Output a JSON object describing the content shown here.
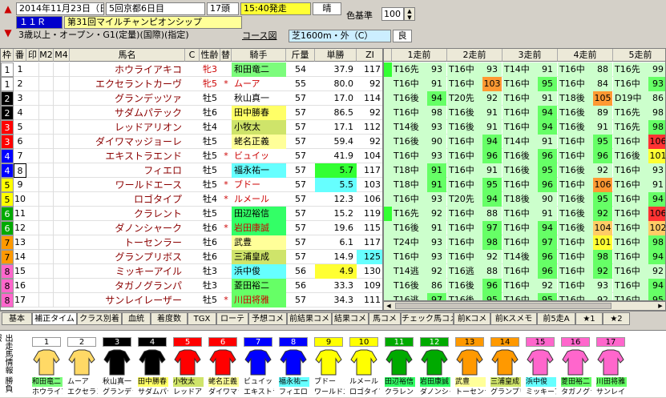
{
  "header": {
    "date": "2014年11月23日（日）",
    "meeting": "5回京都6日目",
    "field": "17頭",
    "post_time": "15:40発走",
    "weather": "晴",
    "race_no": "１１Ｒ",
    "race_name": "第31回マイルチャンピオンシップ",
    "conditions": "3歳以上・オープン・G1(定量)(国際)(指定)",
    "course_btn": "コース図",
    "course": "芝1600m・外（C）",
    "going": "良",
    "color_ref_label": "色基準",
    "color_ref_value": "100"
  },
  "columns": [
    "枠",
    "番",
    "印",
    "M2",
    "M4",
    "馬名",
    "C",
    "性齢",
    "替",
    "騎手",
    "斤量",
    "単勝",
    "ZI"
  ],
  "past_headers": [
    "1走前",
    "2走前",
    "3走前",
    "4走前",
    "5走前"
  ],
  "horses": [
    {
      "waku": "1",
      "ban": "1",
      "name": "ホウライアキコ",
      "sex": "牝3",
      "kae": "",
      "jockey": "和田竜二",
      "jc": "#7cfc7c",
      "weight": "54",
      "odds": "37.9",
      "zi": "117",
      "oc": ""
    },
    {
      "waku": "1",
      "ban": "2",
      "name": "エクセラントカーヴ",
      "sex": "牝5",
      "kae": "*",
      "jockey": "ムーア",
      "jc": "",
      "weight": "55",
      "odds": "80.0",
      "zi": "92",
      "oc": ""
    },
    {
      "waku": "2",
      "ban": "3",
      "name": "グランデッツァ",
      "sex": "牡5",
      "kae": "",
      "jockey": "秋山真一",
      "jc": "",
      "weight": "57",
      "odds": "17.0",
      "zi": "114",
      "oc": ""
    },
    {
      "waku": "2",
      "ban": "4",
      "name": "サダムパテック",
      "sex": "牡6",
      "kae": "",
      "jockey": "田中勝春",
      "jc": "#ffff66",
      "weight": "57",
      "odds": "86.5",
      "zi": "92",
      "oc": ""
    },
    {
      "waku": "3",
      "ban": "5",
      "name": "レッドアリオン",
      "sex": "牡4",
      "kae": "",
      "jockey": "小牧太",
      "jc": "#cfe46a",
      "weight": "57",
      "odds": "17.1",
      "zi": "112",
      "oc": ""
    },
    {
      "waku": "3",
      "ban": "6",
      "name": "ダイワマッジョーレ",
      "sex": "牡5",
      "kae": "",
      "jockey": "蛯名正義",
      "jc": "#ffff99",
      "weight": "57",
      "odds": "59.4",
      "zi": "92",
      "oc": ""
    },
    {
      "waku": "4",
      "ban": "7",
      "name": "エキストラエンド",
      "sex": "牡5",
      "kae": "*",
      "jockey": "ビュイッ",
      "jc": "",
      "weight": "57",
      "odds": "41.9",
      "zi": "104",
      "oc": ""
    },
    {
      "waku": "4",
      "ban": "8",
      "name": "フィエロ",
      "sex": "牡5",
      "kae": "",
      "jockey": "福永祐一",
      "jc": "#66ffff",
      "weight": "57",
      "odds": "5.7",
      "zi": "117",
      "oc": "#33ff33"
    },
    {
      "waku": "5",
      "ban": "9",
      "name": "ワールドエース",
      "sex": "牡5",
      "kae": "*",
      "jockey": "ブドー",
      "jc": "",
      "weight": "57",
      "odds": "5.5",
      "zi": "103",
      "oc": "#66ffff"
    },
    {
      "waku": "5",
      "ban": "10",
      "name": "ロゴタイプ",
      "sex": "牡4",
      "kae": "*",
      "jockey": "ルメール",
      "jc": "",
      "weight": "57",
      "odds": "12.3",
      "zi": "106",
      "oc": ""
    },
    {
      "waku": "6",
      "ban": "11",
      "name": "クラレント",
      "sex": "牡5",
      "kae": "",
      "jockey": "田辺裕信",
      "jc": "#33ff66",
      "weight": "57",
      "odds": "15.2",
      "zi": "119",
      "oc": ""
    },
    {
      "waku": "6",
      "ban": "12",
      "name": "ダノンシャーク",
      "sex": "牡6",
      "kae": "*",
      "jockey": "岩田康誠",
      "jc": "#33ff66",
      "weight": "57",
      "odds": "19.6",
      "zi": "115",
      "oc": ""
    },
    {
      "waku": "7",
      "ban": "13",
      "name": "トーセンラー",
      "sex": "牡6",
      "kae": "",
      "jockey": "武豊",
      "jc": "#ffff99",
      "weight": "57",
      "odds": "6.1",
      "zi": "117",
      "oc": ""
    },
    {
      "waku": "7",
      "ban": "14",
      "name": "グランプリボス",
      "sex": "牡6",
      "kae": "",
      "jockey": "三浦皇成",
      "jc": "#cfe46a",
      "weight": "57",
      "odds": "14.9",
      "zi": "125",
      "oc": ""
    },
    {
      "waku": "8",
      "ban": "15",
      "name": "ミッキーアイル",
      "sex": "牡3",
      "kae": "",
      "jockey": "浜中俊",
      "jc": "#66ffff",
      "weight": "56",
      "odds": "4.9",
      "zi": "130",
      "oc": "#ffff33"
    },
    {
      "waku": "8",
      "ban": "16",
      "name": "タガノグランパ",
      "sex": "牡3",
      "kae": "",
      "jockey": "菱田裕二",
      "jc": "#66ff66",
      "weight": "56",
      "odds": "33.3",
      "zi": "109",
      "oc": ""
    },
    {
      "waku": "8",
      "ban": "17",
      "name": "サンレイレーザー",
      "sex": "牡5",
      "kae": "*",
      "jockey": "川田将雅",
      "jc": "#66ff66",
      "weight": "57",
      "odds": "34.3",
      "zi": "111",
      "oc": ""
    }
  ],
  "past": [
    [
      [
        "T16先",
        "93"
      ],
      [
        "T16中",
        "93"
      ],
      [
        "T14中",
        "91"
      ],
      [
        "T16中",
        "88"
      ],
      [
        "T16先",
        "99"
      ]
    ],
    [
      [
        "T16中",
        "91"
      ],
      [
        "T16中",
        "103"
      ],
      [
        "T16中",
        "95"
      ],
      [
        "T16中",
        "84"
      ],
      [
        "T16中",
        "93"
      ]
    ],
    [
      [
        "T16後",
        "94"
      ],
      [
        "T20先",
        "92"
      ],
      [
        "T16中",
        "91"
      ],
      [
        "T18後",
        "105"
      ],
      [
        "D19中",
        "86"
      ]
    ],
    [
      [
        "T16中",
        "98"
      ],
      [
        "T16後",
        "91"
      ],
      [
        "T16中",
        "94"
      ],
      [
        "T16後",
        "89"
      ],
      [
        "T16先",
        "98"
      ]
    ],
    [
      [
        "T14後",
        "93"
      ],
      [
        "T16後",
        "91"
      ],
      [
        "T16中",
        "94"
      ],
      [
        "T16後",
        "91"
      ],
      [
        "T16先",
        "98"
      ]
    ],
    [
      [
        "T16後",
        "90"
      ],
      [
        "T16中",
        "94"
      ],
      [
        "T14中",
        "91"
      ],
      [
        "T16中",
        "95"
      ],
      [
        "T16中",
        "106"
      ]
    ],
    [
      [
        "T16中",
        "93"
      ],
      [
        "T16中",
        "96"
      ],
      [
        "T16後",
        "96"
      ],
      [
        "T16中",
        "96"
      ],
      [
        "T16後",
        "101"
      ]
    ],
    [
      [
        "T18中",
        "91"
      ],
      [
        "T16中",
        "91"
      ],
      [
        "T16後",
        "95"
      ],
      [
        "T16後",
        "92"
      ],
      [
        "T16中",
        "93"
      ]
    ],
    [
      [
        "T18中",
        "91"
      ],
      [
        "T16中",
        "95"
      ],
      [
        "T16中",
        "96"
      ],
      [
        "T16中",
        "106"
      ],
      [
        "T16中",
        "91"
      ]
    ],
    [
      [
        "T16中",
        "93"
      ],
      [
        "T20先",
        "94"
      ],
      [
        "T18後",
        "90"
      ],
      [
        "T16後",
        "95"
      ],
      [
        "T16中",
        "94"
      ]
    ],
    [
      [
        "T16先",
        "92"
      ],
      [
        "T16中",
        "88"
      ],
      [
        "T16中",
        "91"
      ],
      [
        "T16後",
        "92"
      ],
      [
        "T16中",
        "106"
      ]
    ],
    [
      [
        "T16後",
        "91"
      ],
      [
        "T16中",
        "97"
      ],
      [
        "T16中",
        "94"
      ],
      [
        "T16後",
        "104"
      ],
      [
        "T16中",
        "102"
      ]
    ],
    [
      [
        "T24中",
        "93"
      ],
      [
        "T16中",
        "98"
      ],
      [
        "T16中",
        "97"
      ],
      [
        "T16中",
        "101"
      ],
      [
        "T16中",
        "98"
      ]
    ],
    [
      [
        "T16中",
        "93"
      ],
      [
        "T16中",
        "92"
      ],
      [
        "T14後",
        "96"
      ],
      [
        "T16中",
        "98"
      ],
      [
        "T16中",
        "94"
      ]
    ],
    [
      [
        "T14逃",
        "92"
      ],
      [
        "T16逃",
        "88"
      ],
      [
        "T16中",
        "96"
      ],
      [
        "T16中",
        "92"
      ],
      [
        "T16中",
        "92"
      ]
    ],
    [
      [
        "T16後",
        "86"
      ],
      [
        "T16後",
        "96"
      ],
      [
        "T16中",
        "92"
      ],
      [
        "T16中",
        "93"
      ],
      [
        "T16中",
        "94"
      ]
    ],
    [
      [
        "T16逃",
        "97"
      ],
      [
        "T16後",
        "95"
      ],
      [
        "T16中",
        "95"
      ],
      [
        "T16中",
        "92"
      ],
      [
        "T16中",
        "95"
      ]
    ]
  ],
  "past_colors": [
    [
      "#ccffcc",
      "#ccffcc",
      "#ccffcc",
      "#ccffcc",
      "#ccffcc"
    ],
    [
      "#ccffcc",
      "#ff9933",
      "#66ff66",
      "#ccffcc",
      "#66ff66"
    ],
    [
      "#66ff66",
      "#ccffcc",
      "#ccffcc",
      "#ff9933",
      "#ccffcc"
    ],
    [
      "#ccffcc",
      "#ccffcc",
      "#66ff66",
      "#ccffcc",
      "#ccffcc"
    ],
    [
      "#ccffcc",
      "#ccffcc",
      "#66ff66",
      "#ccffcc",
      "#66ff66"
    ],
    [
      "#ccffcc",
      "#66ff66",
      "#ccffcc",
      "#66ff66",
      "#ff3333"
    ],
    [
      "#ccffcc",
      "#66ff66",
      "#66ff66",
      "#66ff66",
      "#ffff33"
    ],
    [
      "#66ff66",
      "#ccffcc",
      "#66ff66",
      "#ccffcc",
      "#ccffcc"
    ],
    [
      "#66ff66",
      "#66ff66",
      "#66ff66",
      "#ff9933",
      "#ccffcc"
    ],
    [
      "#ccffcc",
      "#66ff66",
      "#ccffcc",
      "#66ff66",
      "#66ff66"
    ],
    [
      "#ccffcc",
      "#ccffcc",
      "#ccffcc",
      "#66ff66",
      "#ff3333"
    ],
    [
      "#ccffcc",
      "#66ff66",
      "#66ff66",
      "#ffcc66",
      "#ffcc66"
    ],
    [
      "#ccffcc",
      "#66ff66",
      "#66ff66",
      "#ffff33",
      "#66ff66"
    ],
    [
      "#ccffcc",
      "#ccffcc",
      "#66ff66",
      "#66ff66",
      "#66ff66"
    ],
    [
      "#ccffcc",
      "#ccffcc",
      "#66ff66",
      "#66ff66",
      "#ccffcc"
    ],
    [
      "#ccffcc",
      "#66ff66",
      "#ccffcc",
      "#ccffcc",
      "#66ff66"
    ],
    [
      "#66ff66",
      "#66ff66",
      "#66ff66",
      "#ccffcc",
      "#66ff66"
    ]
  ],
  "tabs": [
    "基本",
    "補正タイム",
    "クラス別着",
    "血統",
    "着度数",
    "TGX",
    "ローテ",
    "予想コメ",
    "前結果コメ",
    "結果コメ",
    "馬コメ",
    "チェック馬コメ",
    "前Kコメ",
    "前Kスメモ",
    "前5走A",
    "★1",
    "★2"
  ],
  "side_label": "出走馬情報 勝負服",
  "waku_colors": {
    "1": [
      "#ffffff",
      "#000000"
    ],
    "2": [
      "#000000",
      "#ffffff"
    ],
    "3": [
      "#ff0000",
      "#ffffff"
    ],
    "4": [
      "#0000ff",
      "#ffffff"
    ],
    "5": [
      "#ffff00",
      "#000000"
    ],
    "6": [
      "#00aa00",
      "#ffffff"
    ],
    "7": [
      "#ff9900",
      "#000000"
    ],
    "8": [
      "#ff66cc",
      "#000000"
    ]
  }
}
